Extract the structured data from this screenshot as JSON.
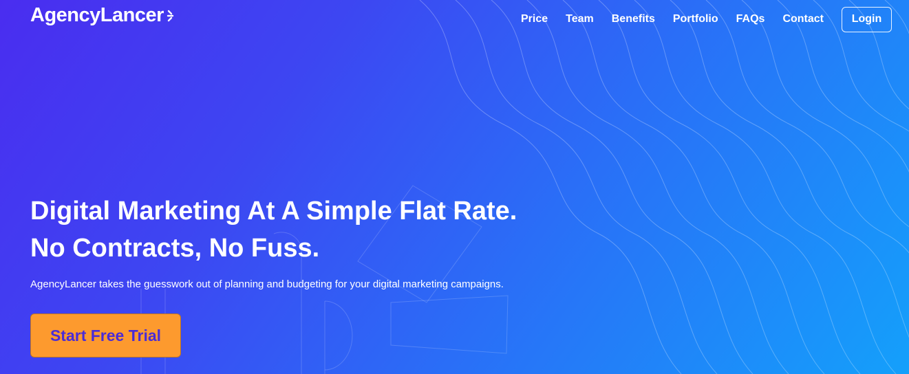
{
  "brand": {
    "name": "AgencyLancer"
  },
  "nav": {
    "items": [
      {
        "label": "Price"
      },
      {
        "label": "Team"
      },
      {
        "label": "Benefits"
      },
      {
        "label": "Portfolio"
      },
      {
        "label": "FAQs"
      },
      {
        "label": "Contact"
      }
    ],
    "login_label": "Login"
  },
  "hero": {
    "headline_line1": "Digital Marketing At A Simple Flat Rate.",
    "headline_line2": "No Contracts, No Fuss.",
    "subtitle": "AgencyLancer takes the guesswork out of planning and budgeting for your digital marketing campaigns.",
    "cta_label": "Start Free Trial"
  },
  "colors": {
    "gradient_start": "#4a2df0",
    "gradient_end": "#14a0fb",
    "cta_background": "#fd9a2e",
    "cta_text": "#4a2cd6"
  }
}
